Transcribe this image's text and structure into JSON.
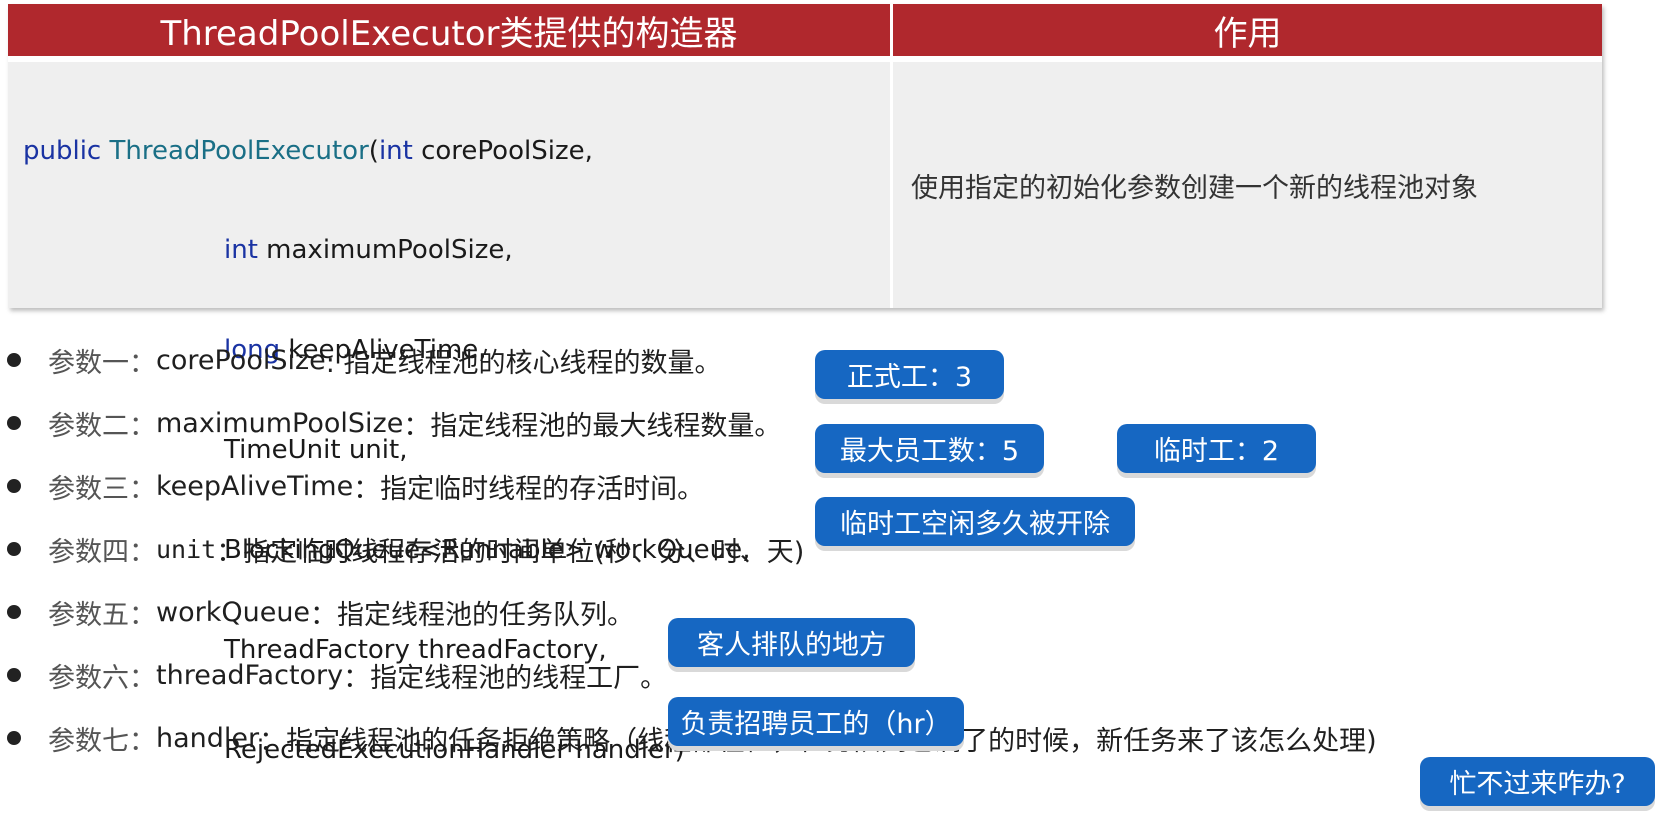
{
  "table": {
    "header_constructor": "ThreadPoolExecutor类提供的构造器",
    "header_purpose": "作用",
    "code": {
      "l1_kw": "public ",
      "l1_cls": "ThreadPoolExecutor",
      "l1_paren": "(",
      "l1_type": "int",
      "l1_rest": " corePoolSize,",
      "l2_type": "int",
      "l2_rest": " maximumPoolSize,",
      "l3_type": "long",
      "l3_rest": " keepAliveTime,",
      "l4": "TimeUnit unit,",
      "l5": "BlockingQueue<Runnable> workQueue,",
      "l6": "ThreadFactory threadFactory,",
      "l7": "RejectedExecutionHandler handler)"
    },
    "description": "使用指定的初始化参数创建一个新的线程池对象"
  },
  "params": [
    {
      "label": "参数一：",
      "name": "corePoolSize",
      "desc": " : 指定线程池的核心线程的数量。"
    },
    {
      "label": "参数二：",
      "name": "maximumPoolSize",
      "desc": "：指定线程池的最大线程数量。"
    },
    {
      "label": "参数三：",
      "name": "keepAliveTime",
      "desc": " ：指定临时线程的存活时间。"
    },
    {
      "label": "参数四：",
      "name": "unit",
      "desc": "：指定临时线程存活的时间单位(秒、分、时、天)"
    },
    {
      "label": "参数五：",
      "name": "workQueue",
      "desc": "：指定线程池的任务队列。"
    },
    {
      "label": "参数六：",
      "name": "threadFactory",
      "desc": "：指定线程池的线程工厂。"
    },
    {
      "label": "参数七：",
      "name": "handler",
      "desc": "：指定线程池的任务拒绝策略（线程都在忙，任务队列也满了的时候，新任务来了该怎么处理)"
    }
  ],
  "badges": {
    "formal_workers": "正式工：3",
    "max_employees": "最大员工数：5",
    "temp_workers": "临时工：2",
    "temp_idle": "临时工空闲多久被开除",
    "customer_queue": "客人排队的地方",
    "hr": "负责招聘员工的（hr）",
    "too_busy": "忙不过来咋办?"
  },
  "colors": {
    "header_red": "#b0282d",
    "badge_blue": "#1667c2",
    "keyword_blue": "#1a33a3",
    "class_teal": "#1a6f86",
    "cell_gray": "#efefef"
  }
}
